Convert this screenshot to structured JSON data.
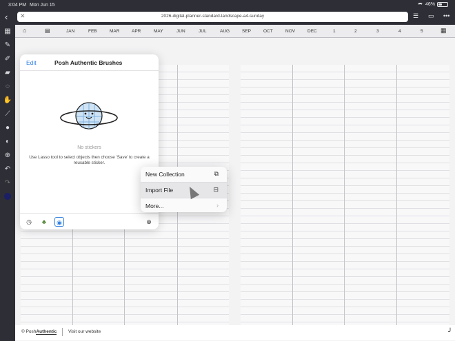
{
  "status": {
    "time": "3:04 PM",
    "date": "Mon Jun 15",
    "battery": "46%"
  },
  "toolbar": {
    "doc_title": "2026-digital-planner-standard-landscape-a4-sunday"
  },
  "planner_nav": [
    "JAN",
    "FEB",
    "MAR",
    "APR",
    "MAY",
    "JUN",
    "JUL",
    "AUG",
    "SEP",
    "OCT",
    "NOV",
    "DEC",
    "1",
    "2",
    "3",
    "4",
    "5"
  ],
  "stickers_panel": {
    "edit_label": "Edit",
    "title": "Posh Authentic Brushes",
    "empty_label": "No stickers",
    "help_text": "Use Lasso tool to select objects then choose 'Save' to create a reusable sticker."
  },
  "menu": {
    "items": [
      {
        "label": "New Collection",
        "icon": "new-collection-icon"
      },
      {
        "label": "Import File",
        "icon": "drive-icon"
      },
      {
        "label": "More...",
        "icon": "chevron-right-icon"
      }
    ]
  },
  "footer": {
    "copyright_prefix": "© Posh",
    "copyright_brand": "Authentic",
    "visit_label": "Visit our website"
  },
  "colors": {
    "accent": "#2f7fe0",
    "sidebar": "#2e2e36",
    "selected_color": "#1a1f66"
  }
}
